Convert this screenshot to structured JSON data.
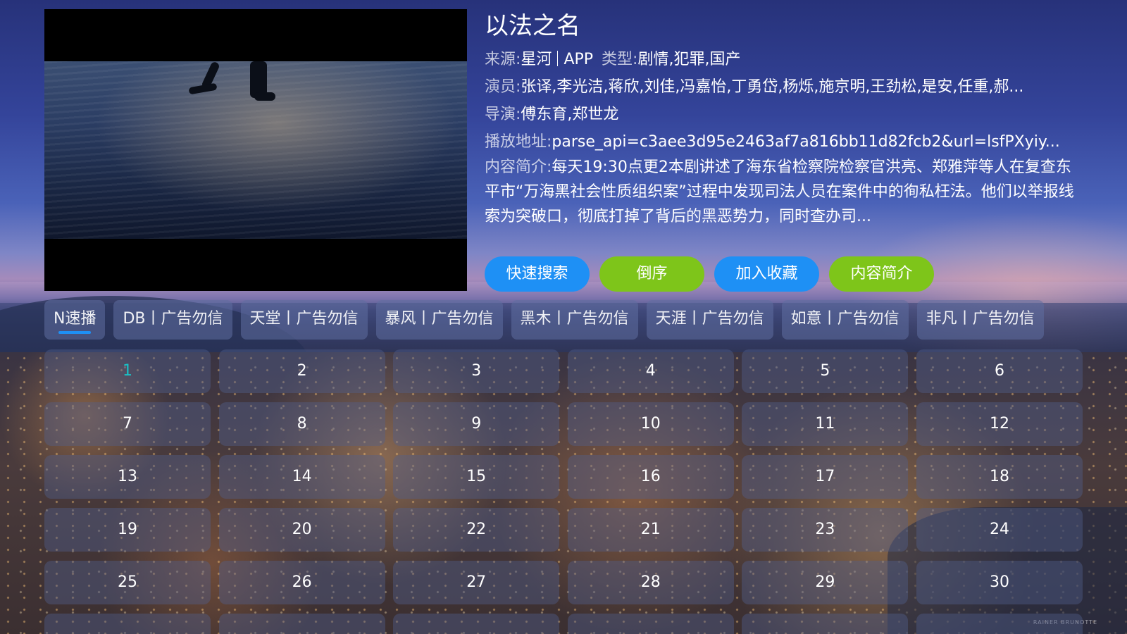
{
  "video": {
    "title": "以法之名",
    "source_label": "来源:",
    "source_name": "星河",
    "source_app": "APP",
    "genre_label": "类型:",
    "genre": "剧情,犯罪,国产",
    "cast_label": "演员:",
    "cast": "张译,李光洁,蒋欣,刘佳,冯嘉怡,丁勇岱,杨烁,施京明,王劲松,是安,任重,郝...",
    "director_label": "导演:",
    "director": "傅东育,郑世龙",
    "play_url_label": "播放地址:",
    "play_url": "parse_api=c3aee3d95e2463af7a816bb11d82fcb2&url=lsfPXyiy...",
    "summary_label": "内容简介:",
    "summary": "每天19:30点更2本剧讲述了海东省检察院检察官洪亮、郑雅萍等人在复查东平市“万海黑社会性质组织案”过程中发现司法人员在案件中的徇私枉法。他们以举报线索为突破口，彻底打掉了背后的黑恶势力，同时查办司..."
  },
  "actions": [
    {
      "label": "快速搜索",
      "color": "#1e90f5"
    },
    {
      "label": "倒序",
      "color": "#7ec51a"
    },
    {
      "label": "加入收藏",
      "color": "#1e90f5"
    },
    {
      "label": "内容简介",
      "color": "#7ec51a"
    }
  ],
  "sources": [
    {
      "label": "N速播",
      "selected": true
    },
    {
      "label": "DB丨广告勿信"
    },
    {
      "label": "天堂丨广告勿信"
    },
    {
      "label": "暴风丨广告勿信"
    },
    {
      "label": "黑木丨广告勿信"
    },
    {
      "label": "天涯丨广告勿信"
    },
    {
      "label": "如意丨广告勿信"
    },
    {
      "label": "非凡丨广告勿信"
    }
  ],
  "episodes": [
    "1",
    "2",
    "3",
    "4",
    "5",
    "6",
    "7",
    "8",
    "9",
    "10",
    "11",
    "12",
    "13",
    "14",
    "15",
    "16",
    "17",
    "18",
    "19",
    "20",
    "22",
    "21",
    "23",
    "24",
    "25",
    "26",
    "27",
    "28",
    "29",
    "30",
    "",
    "",
    "",
    "",
    "",
    ""
  ],
  "active_episode": "1",
  "accent_color": "#19c2c8",
  "background_credit": "RAINER BRUNOTTE"
}
